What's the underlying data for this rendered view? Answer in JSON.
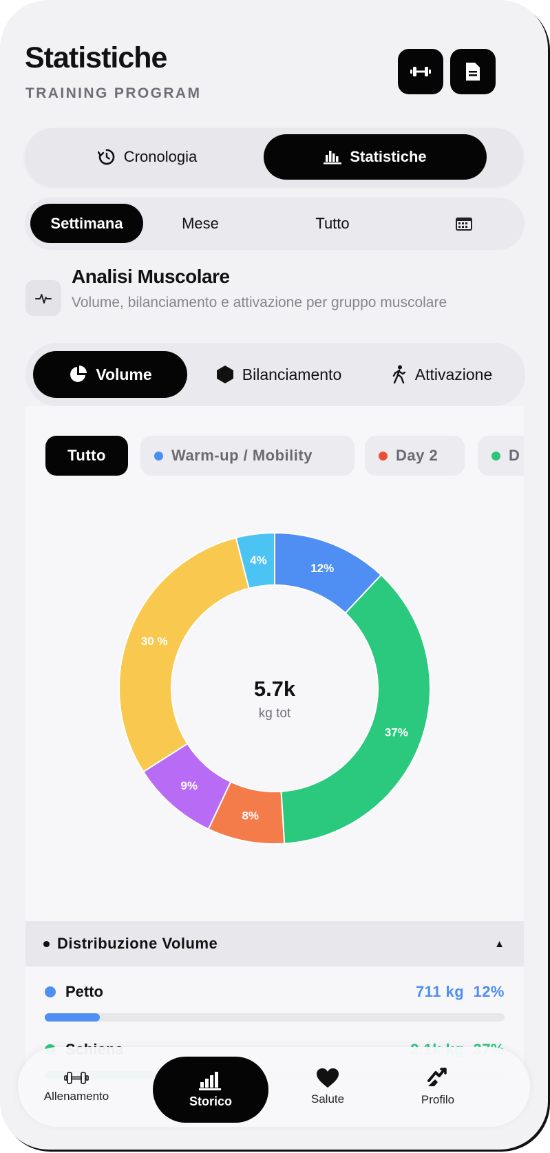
{
  "header": {
    "title": "Statistiche",
    "subtitle": "TRAINING PROGRAM",
    "icons": [
      "dumbbell-icon",
      "document-icon"
    ]
  },
  "view_toggle": {
    "items": [
      {
        "label": "Cronologia",
        "icon": "history-icon"
      },
      {
        "label": "Statistiche",
        "icon": "bar-chart-icon",
        "selected": true
      }
    ]
  },
  "period": {
    "items": [
      "Settimana",
      "Mese",
      "Tutto"
    ],
    "selected": "Settimana",
    "calendar_icon": "calendar-icon"
  },
  "section": {
    "title": "Analisi Muscolare",
    "description": "Volume, bilanciamento e attivazione per gruppo muscolare",
    "icon": "pulse-icon"
  },
  "analysis_tabs": {
    "items": [
      {
        "label": "Volume",
        "icon": "pie-icon",
        "selected": true
      },
      {
        "label": "Bilanciamento",
        "icon": "hexagon-icon"
      },
      {
        "label": "Attivazione",
        "icon": "walking-icon"
      }
    ]
  },
  "filters": {
    "items": [
      {
        "label": "Tutto",
        "selected": true
      },
      {
        "label": "Warm-up / Mobility",
        "color": "#4a8ef0"
      },
      {
        "label": "Day 2",
        "color": "#e8503a"
      },
      {
        "label": "D",
        "color": "#2ec57a"
      }
    ]
  },
  "chart_data": {
    "type": "pie",
    "donut": true,
    "center_value": "5.7k",
    "center_label": "kg tot",
    "slices": [
      {
        "label": "12%",
        "value": 12,
        "color": "#4f8ef3"
      },
      {
        "label": "37%",
        "value": 37,
        "color": "#2ac97d"
      },
      {
        "label": "8%",
        "value": 8,
        "color": "#f47c4a"
      },
      {
        "label": "9%",
        "value": 9,
        "color": "#b86cf5"
      },
      {
        "label": "30 %",
        "value": 30,
        "color": "#f8c94e"
      },
      {
        "label": "4%",
        "value": 4,
        "color": "#4cc4f3"
      }
    ]
  },
  "distribution": {
    "title": "Distribuzione Volume",
    "toggle_glyph": "▲",
    "rows": [
      {
        "name": "Petto",
        "kg": "711 kg",
        "pct": "12%",
        "fraction": 0.12,
        "color": "#4f8ef3"
      },
      {
        "name": "Schiena",
        "kg": "2.1k kg",
        "pct": "37%",
        "fraction": 0.37,
        "color": "#2ac97d"
      }
    ]
  },
  "nav": {
    "items": [
      {
        "label": "Allenamento",
        "icon": "dumbbell-icon"
      },
      {
        "label": "Storico",
        "icon": "bar-chart-icon",
        "active": true
      },
      {
        "label": "Salute",
        "icon": "heart-icon"
      },
      {
        "label": "Profilo",
        "icon": "profile-icon"
      }
    ]
  }
}
